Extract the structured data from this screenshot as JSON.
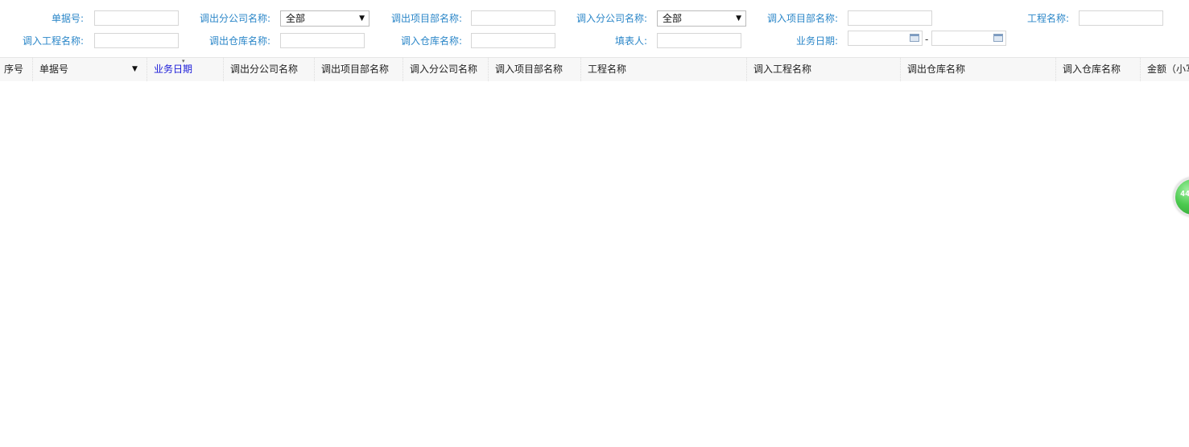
{
  "filters": {
    "doc_no_label": "单据号:",
    "out_branch_label": "调出分公司名称:",
    "out_branch_value": "全部",
    "out_project_label": "调出项目部名称:",
    "in_branch_label": "调入分公司名称:",
    "in_branch_value": "全部",
    "in_project_label": "调入项目部名称:",
    "project_label": "工程名称:",
    "in_project_name_label": "调入工程名称:",
    "out_warehouse_label": "调出仓库名称:",
    "in_warehouse_label": "调入仓库名称:",
    "filler_label": "填表人:",
    "biz_date_label": "业务日期:",
    "date_separator": "-"
  },
  "grid": {
    "columns": [
      "序号",
      "单据号",
      "业务日期",
      "调出分公司名称",
      "调出项目部名称",
      "调入分公司名称",
      "调入项目部名称",
      "工程名称",
      "调入工程名称",
      "调出仓库名称",
      "调入仓库名称",
      "金额（小写"
    ],
    "sorted_column": "业务日期",
    "sort_indicator": "▾"
  },
  "float_button": {
    "label": "44"
  },
  "colors": {
    "label": "#2a86c8",
    "sorted_header": "#1a1ad8",
    "float_button": "#4bc94e"
  }
}
